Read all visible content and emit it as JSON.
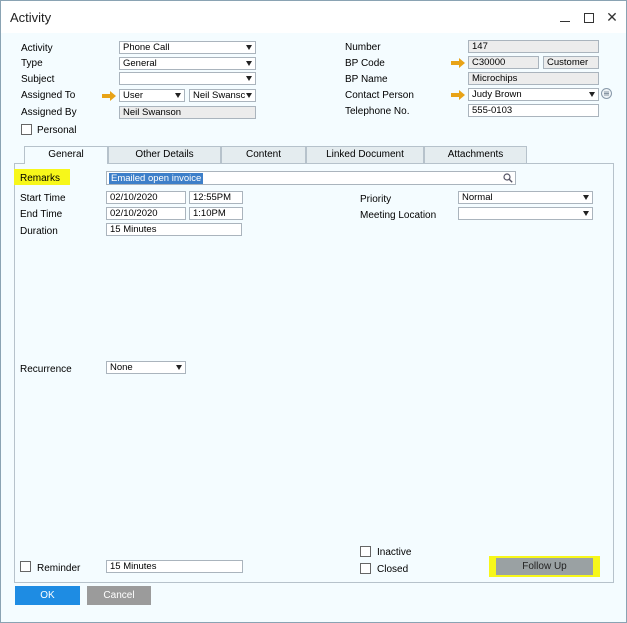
{
  "window": {
    "title": "Activity"
  },
  "header_left": {
    "activity_label": "Activity",
    "activity_value": "Phone Call",
    "type_label": "Type",
    "type_value": "General",
    "subject_label": "Subject",
    "subject_value": "",
    "assigned_to_label": "Assigned To",
    "assigned_to_type": "User",
    "assigned_to_value": "Neil Swansc",
    "assigned_by_label": "Assigned By",
    "assigned_by_value": "Neil Swanson",
    "personal_label": "Personal"
  },
  "header_right": {
    "number_label": "Number",
    "number_value": "147",
    "bp_code_label": "BP Code",
    "bp_code_value": "C30000",
    "bp_type_value": "Customer",
    "bp_name_label": "BP Name",
    "bp_name_value": "Microchips",
    "contact_person_label": "Contact Person",
    "contact_person_value": "Judy Brown",
    "telephone_label": "Telephone No.",
    "telephone_value": "555-0103"
  },
  "tabs": [
    {
      "label": "General",
      "active": true
    },
    {
      "label": "Other Details",
      "active": false
    },
    {
      "label": "Content",
      "active": false
    },
    {
      "label": "Linked Document",
      "active": false
    },
    {
      "label": "Attachments",
      "active": false
    }
  ],
  "general": {
    "remarks_label": "Remarks",
    "remarks_value": "Emailed open invoice",
    "start_time_label": "Start Time",
    "start_date": "02/10/2020",
    "start_time": "12:55PM",
    "end_time_label": "End Time",
    "end_date": "02/10/2020",
    "end_time": "1:10PM",
    "duration_label": "Duration",
    "duration_value": "15 Minutes",
    "priority_label": "Priority",
    "priority_value": "Normal",
    "meeting_location_label": "Meeting Location",
    "meeting_location_value": "",
    "recurrence_label": "Recurrence",
    "recurrence_value": "None",
    "reminder_label": "Reminder",
    "reminder_value": "15 Minutes",
    "inactive_label": "Inactive",
    "closed_label": "Closed"
  },
  "footer": {
    "ok_label": "OK",
    "cancel_label": "Cancel",
    "follow_up_label": "Follow Up"
  },
  "colors": {
    "highlight": "#f7f71a",
    "ok_button": "#1e8ce3",
    "cancel_button": "#9b9b9b",
    "link_arrow": "#e8a317"
  }
}
